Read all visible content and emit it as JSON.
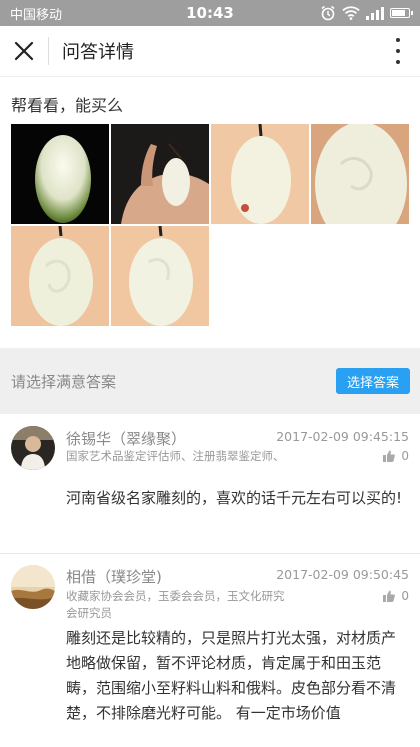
{
  "status_bar": {
    "carrier": "中国移动",
    "time": "10:43"
  },
  "nav": {
    "title": "问答详情",
    "close_icon": "close-icon",
    "more_icon": "more-vertical-icon"
  },
  "question": {
    "text": "帮看看，能买么",
    "images": [
      "jade-pendant-photo",
      "jade-pendant-in-hand-photo",
      "jade-pendant-back-photo",
      "jade-pendant-closeup-photo",
      "jade-pendant-front-photo",
      "jade-pendant-side-photo"
    ]
  },
  "select_bar": {
    "hint": "请选择满意答案",
    "button_label": "选择答案"
  },
  "answers": [
    {
      "name": "徐锡华（翠缘聚）",
      "time": "2017-02-09 09:45:15",
      "titles": "国家艺术品鉴定评估师、注册翡翠鉴定师、",
      "likes": "0",
      "content": "河南省级名家雕刻的，喜欢的话千元左右可以买的!"
    },
    {
      "name": "相借（璞珍堂)",
      "time": "2017-02-09 09:50:45",
      "titles": "收藏家协会会员，玉委会会员，玉文化研究会研究员",
      "likes": "0",
      "content": "雕刻还是比较精的，只是照片打光太强，对材质产地略做保留，暂不评论材质，肯定属于和田玉范畴，范围缩小至籽料山料和俄料。皮色部分看不清楚，不排除磨光籽可能。 有一定市场价值"
    }
  ],
  "colors": {
    "accent": "#29a0f1",
    "status_bar": "#9e9e9e",
    "section_bg": "#efefef"
  }
}
